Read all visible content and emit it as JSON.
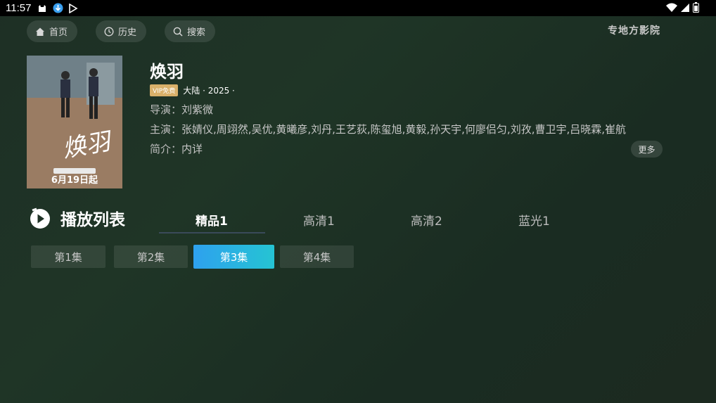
{
  "status_bar": {
    "time": "11:57"
  },
  "nav": {
    "home_label": "首页",
    "history_label": "历史",
    "search_label": "搜索"
  },
  "brand": "专地方影院",
  "poster": {
    "caption": "6月19日起",
    "title_art": "焕羽"
  },
  "detail": {
    "title": "焕羽",
    "vip_badge": "VIP免费",
    "region_year": "大陆 · 2025 ·",
    "director_key": "导演：",
    "director": "刘紫微",
    "cast_key": "主演：",
    "cast": "张婧仪,周翊然,吴优,黄曦彦,刘丹,王艺荻,陈玺旭,黄毅,孙天宇,何廖侣匀,刘孜,曹卫宇,吕晓霖,崔航",
    "intro_key": "简介：",
    "intro": "内详",
    "more_label": "更多"
  },
  "playlist": {
    "title": "播放列表",
    "sources": [
      "精品1",
      "高清1",
      "高清2",
      "蓝光1"
    ],
    "active_source": "精品1",
    "episodes": [
      "第1集",
      "第2集",
      "第3集",
      "第4集"
    ],
    "active_episode": "第3集"
  },
  "colors": {
    "accent_start": "#2ea1ee",
    "accent_end": "#25c4d3",
    "vip": "#d9b06a"
  }
}
